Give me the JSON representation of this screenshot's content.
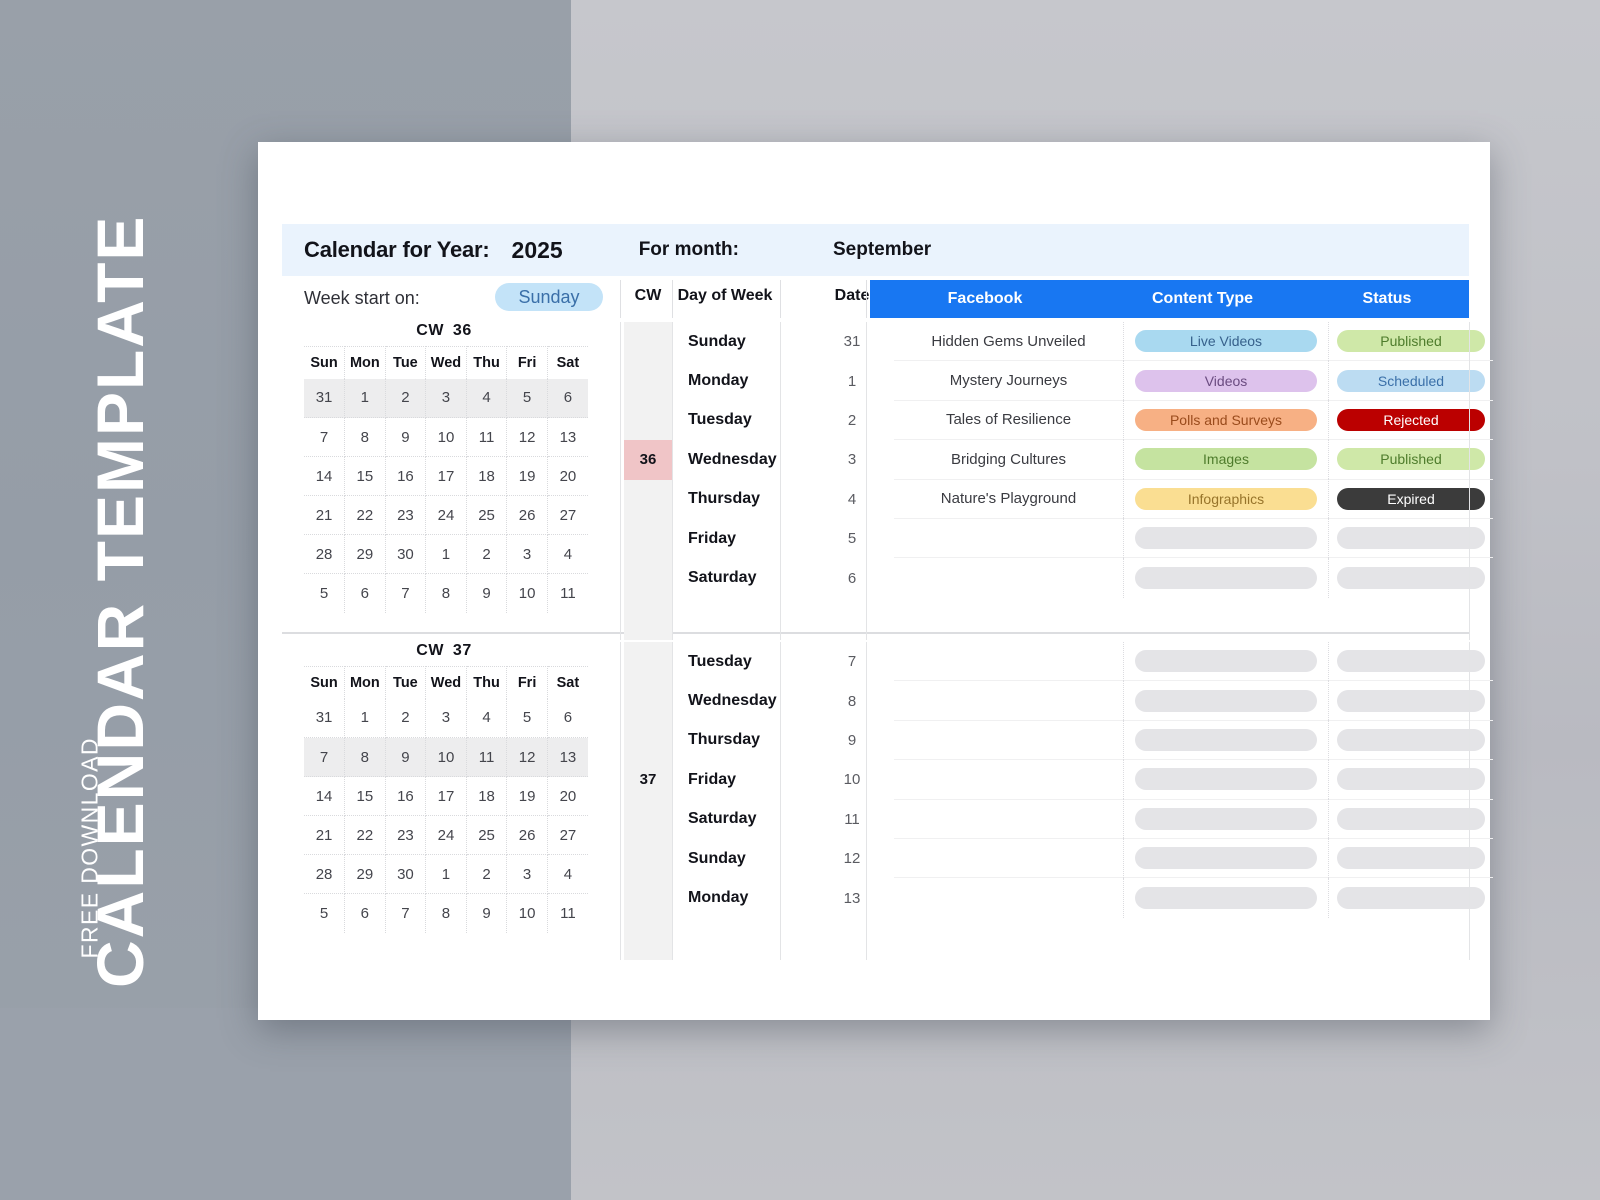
{
  "promo": {
    "title": "CALENDAR TEMPLATE",
    "subtitle": "FREE DOWNLOAD"
  },
  "header": {
    "calendar_label": "Calendar for Year:",
    "year": "2025",
    "for_month_label": "For month:",
    "month": "September"
  },
  "controls": {
    "week_start_label": "Week start on:",
    "week_start_value": "Sunday"
  },
  "columns": {
    "cw": "CW",
    "day_of_week": "Day of Week",
    "date": "Date",
    "facebook": "Facebook",
    "content_type": "Content Type",
    "status": "Status"
  },
  "colors": {
    "brand_blue": "#1877f2",
    "header_bar": "#eaf3fd",
    "pill_blue_bg": "#c3e3f8",
    "pill_blue_text": "#3a6fa8",
    "cw_highlight": "#f0c5c7",
    "week_highlight": "#ededee",
    "cw_band": "#f2f2f2",
    "placeholder": "#e4e4e7",
    "page_left": "#959da7",
    "page_right": "#c0c1c7"
  },
  "weekday_headers": [
    "Sun",
    "Mon",
    "Tue",
    "Wed",
    "Thu",
    "Fri",
    "Sat"
  ],
  "sections": [
    {
      "cw_label": "CW",
      "cw_number": "36",
      "grid": [
        [
          "31",
          "1",
          "2",
          "3",
          "4",
          "5",
          "6"
        ],
        [
          "7",
          "8",
          "9",
          "10",
          "11",
          "12",
          "13"
        ],
        [
          "14",
          "15",
          "16",
          "17",
          "18",
          "19",
          "20"
        ],
        [
          "21",
          "22",
          "23",
          "24",
          "25",
          "26",
          "27"
        ],
        [
          "28",
          "29",
          "30",
          "1",
          "2",
          "3",
          "4"
        ],
        [
          "5",
          "6",
          "7",
          "8",
          "9",
          "10",
          "11"
        ]
      ],
      "highlight_row": 0,
      "days": [
        {
          "cw": "",
          "day": "Sunday",
          "date": "31"
        },
        {
          "cw": "",
          "day": "Monday",
          "date": "1"
        },
        {
          "cw": "",
          "day": "Tuesday",
          "date": "2"
        },
        {
          "cw": "36",
          "day": "Wednesday",
          "date": "3"
        },
        {
          "cw": "",
          "day": "Thursday",
          "date": "4"
        },
        {
          "cw": "",
          "day": "Friday",
          "date": "5"
        },
        {
          "cw": "",
          "day": "Saturday",
          "date": "6"
        }
      ],
      "cw_marked_index": 3,
      "rows": [
        {
          "facebook": "Hidden Gems Unveiled",
          "content_type": "Live Videos",
          "content_type_bg": "#a9d9f0",
          "content_type_fg": "#37618b",
          "status": "Published",
          "status_bg": "#cfe8a8",
          "status_fg": "#4e7c2c"
        },
        {
          "facebook": "Mystery Journeys",
          "content_type": "Videos",
          "content_type_bg": "#ddc2ec",
          "content_type_fg": "#6a4b80",
          "status": "Scheduled",
          "status_bg": "#bcdcf2",
          "status_fg": "#3a6fa8"
        },
        {
          "facebook": "Tales of Resilience",
          "content_type": "Polls and Surveys",
          "content_type_bg": "#f7b084",
          "content_type_fg": "#9a4b1c",
          "status": "Rejected",
          "status_bg": "#bb0000",
          "status_fg": "#ffffff"
        },
        {
          "facebook": "Bridging Cultures",
          "content_type": "Images",
          "content_type_bg": "#c5e3a0",
          "content_type_fg": "#4e7c2c",
          "status": "Published",
          "status_bg": "#cfe8a8",
          "status_fg": "#4e7c2c"
        },
        {
          "facebook": "Nature's Playground",
          "content_type": "Infographics",
          "content_type_bg": "#fade92",
          "content_type_fg": "#97742a",
          "status": "Expired",
          "status_bg": "#3b3b3b",
          "status_fg": "#ffffff"
        },
        {
          "facebook": "",
          "content_type": "",
          "status": ""
        },
        {
          "facebook": "",
          "content_type": "",
          "status": ""
        }
      ]
    },
    {
      "cw_label": "CW",
      "cw_number": "37",
      "grid": [
        [
          "31",
          "1",
          "2",
          "3",
          "4",
          "5",
          "6"
        ],
        [
          "7",
          "8",
          "9",
          "10",
          "11",
          "12",
          "13"
        ],
        [
          "14",
          "15",
          "16",
          "17",
          "18",
          "19",
          "20"
        ],
        [
          "21",
          "22",
          "23",
          "24",
          "25",
          "26",
          "27"
        ],
        [
          "28",
          "29",
          "30",
          "1",
          "2",
          "3",
          "4"
        ],
        [
          "5",
          "6",
          "7",
          "8",
          "9",
          "10",
          "11"
        ]
      ],
      "highlight_row": 1,
      "days": [
        {
          "cw": "",
          "day": "Tuesday",
          "date": "7"
        },
        {
          "cw": "",
          "day": "Wednesday",
          "date": "8"
        },
        {
          "cw": "",
          "day": "Thursday",
          "date": "9"
        },
        {
          "cw": "37",
          "day": "Friday",
          "date": "10"
        },
        {
          "cw": "",
          "day": "Saturday",
          "date": "11"
        },
        {
          "cw": "",
          "day": "Sunday",
          "date": "12"
        },
        {
          "cw": "",
          "day": "Monday",
          "date": "13"
        }
      ],
      "cw_marked_index": -1,
      "rows": [
        {
          "facebook": "",
          "content_type": "",
          "status": ""
        },
        {
          "facebook": "",
          "content_type": "",
          "status": ""
        },
        {
          "facebook": "",
          "content_type": "",
          "status": ""
        },
        {
          "facebook": "",
          "content_type": "",
          "status": ""
        },
        {
          "facebook": "",
          "content_type": "",
          "status": ""
        },
        {
          "facebook": "",
          "content_type": "",
          "status": ""
        },
        {
          "facebook": "",
          "content_type": "",
          "status": ""
        }
      ]
    }
  ]
}
